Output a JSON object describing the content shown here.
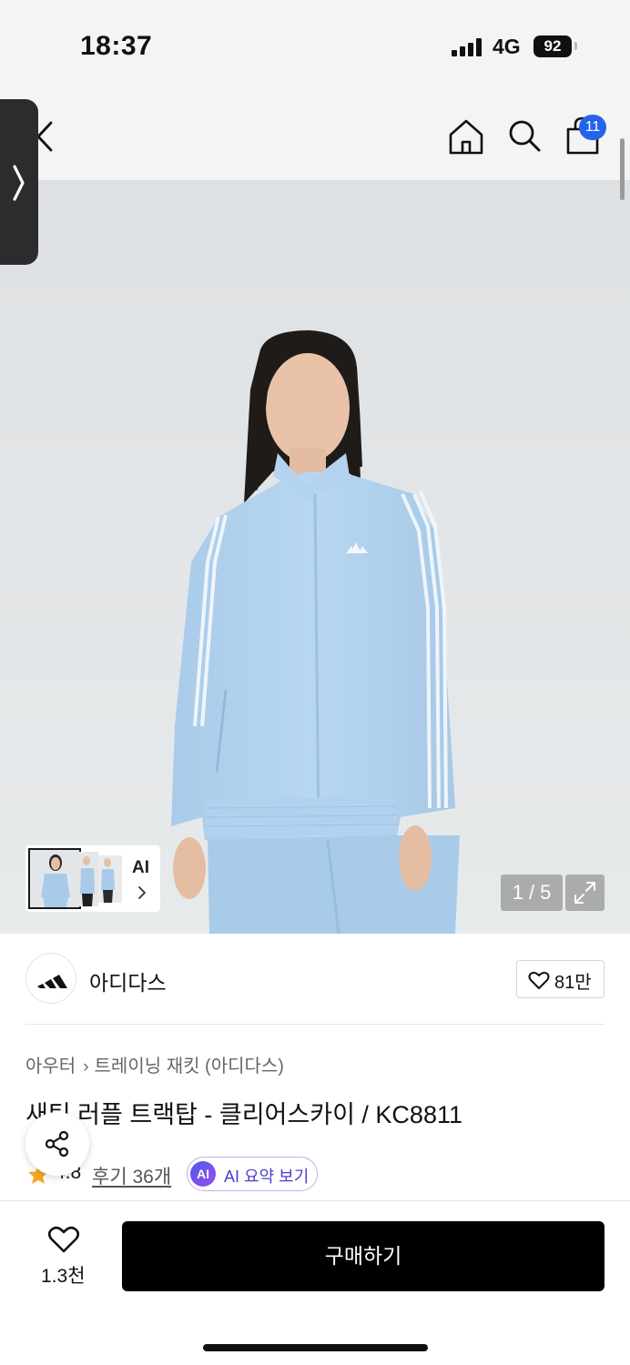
{
  "status_bar": {
    "time": "18:37",
    "network": "4G",
    "battery": "92"
  },
  "nav": {
    "back_icon": "chevron-left-icon",
    "home_icon": "home-icon",
    "search_icon": "search-icon",
    "cart_icon": "shopping-bag-icon",
    "cart_count": "11"
  },
  "gallery": {
    "ai_label": "AI",
    "current_page": "1",
    "separator": "/",
    "total_pages": "5",
    "counter_text": "1 / 5",
    "expand_icon": "expand-icon"
  },
  "brand": {
    "name": "아디다스",
    "logo_icon": "adidas-logo-icon",
    "like_count": "81만"
  },
  "product": {
    "breadcrumb": [
      "아우터",
      "트레이닝 재킷 (아디다스)"
    ],
    "title": "새틴 러플 트랙탑 - 클리어스카이 / KC8811",
    "rating": "4.8",
    "review_link": "후기 36개",
    "ai_badge": "AI",
    "ai_summary_label": "AI 요약 보기"
  },
  "bottom_bar": {
    "wish_count": "1.3천",
    "buy_label": "구매하기"
  },
  "colors": {
    "accent_blue": "#2563eb",
    "buy_button": "#000000",
    "ai_purple": "#4b3fd1",
    "star": "#f5a623"
  }
}
